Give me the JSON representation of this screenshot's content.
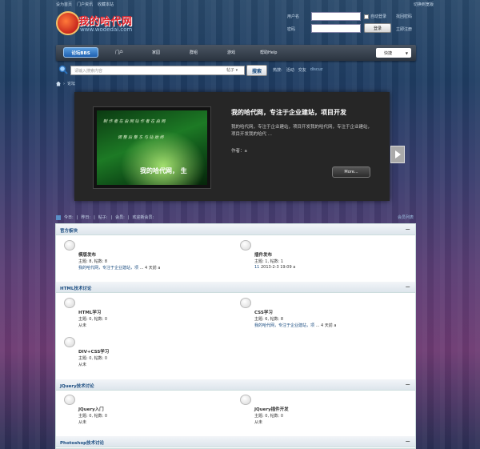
{
  "top": {
    "links": [
      "设为首页",
      "门户资讯",
      "收藏本站"
    ],
    "switch_style": "切换到宽版"
  },
  "logo": {
    "title": "我的哈代网",
    "url": "www.wodedai.com"
  },
  "login": {
    "username_label": "用户名",
    "password_label": "密码",
    "autologin": "自动登录",
    "forgot": "找回密码",
    "login_button": "登录",
    "register": "立即注册"
  },
  "nav": {
    "items": [
      "论坛BBS",
      "门户",
      "家园",
      "群组",
      "游戏",
      "帮助Help"
    ],
    "quick": "快捷"
  },
  "search": {
    "placeholder": "请输入搜索内容",
    "type": "帖子",
    "button": "搜索",
    "hot_label": "热搜:",
    "hot": [
      "活动",
      "交友",
      "discuz"
    ]
  },
  "breadcrumb": {
    "current": "论坛"
  },
  "slider": {
    "title": "我的哈代网，专注于企业建站，项目开发",
    "desc": "我的哈代网，专注于企业建站，项目开发我的哈代网，专注于企业建站，项目开发我的哈代 ...",
    "author": "作者：a",
    "more": "More...",
    "img_line1": "制  作  者    在  由  网  站  作  者    在  由  网",
    "img_line2": "调  整  后  整  东  与  站  始  终",
    "img_caption": "我的哈代网，  生"
  },
  "stats": {
    "items": [
      "今日:",
      "昨日:",
      "帖子:",
      "会员:",
      "欢迎新会员:"
    ],
    "member_list": "会员列表"
  },
  "categories": [
    {
      "name": "官方板块",
      "forums": [
        {
          "name": "模版发布",
          "stats": "主题: 8, 帖数: 8",
          "last_link": "我的哈代网，专注于企业建站，项",
          "last_time": "... 4 天前",
          "last_user": "a"
        },
        {
          "name": "插件发布",
          "stats": "主题: 1, 帖数: 1",
          "last_link": "11",
          "last_time": "2013-2-3 19:09",
          "last_user": "a"
        }
      ]
    },
    {
      "name": "HTML技术讨论",
      "forums": [
        {
          "name": "HTML学习",
          "stats": "主题: 0, 帖数: 0",
          "last_link": "",
          "last_time": "从未",
          "last_user": ""
        },
        {
          "name": "CSS学习",
          "stats": "主题: 6, 帖数: 8",
          "last_link": "我的哈代网，专注于企业建站，项",
          "last_time": "... 4 天前",
          "last_user": "a"
        },
        {
          "name": "DIV+CSS学习",
          "stats": "主题: 0, 帖数: 0",
          "last_link": "",
          "last_time": "从未",
          "last_user": ""
        }
      ]
    },
    {
      "name": "JQuery技术讨论",
      "forums": [
        {
          "name": "JQuery入门",
          "stats": "主题: 0, 帖数: 0",
          "last_link": "",
          "last_time": "从未",
          "last_user": ""
        },
        {
          "name": "JQuery插件开发",
          "stats": "主题: 0, 帖数: 0",
          "last_link": "",
          "last_time": "从未",
          "last_user": ""
        }
      ]
    },
    {
      "name": "Photoshop技术讨论",
      "forums": []
    }
  ]
}
